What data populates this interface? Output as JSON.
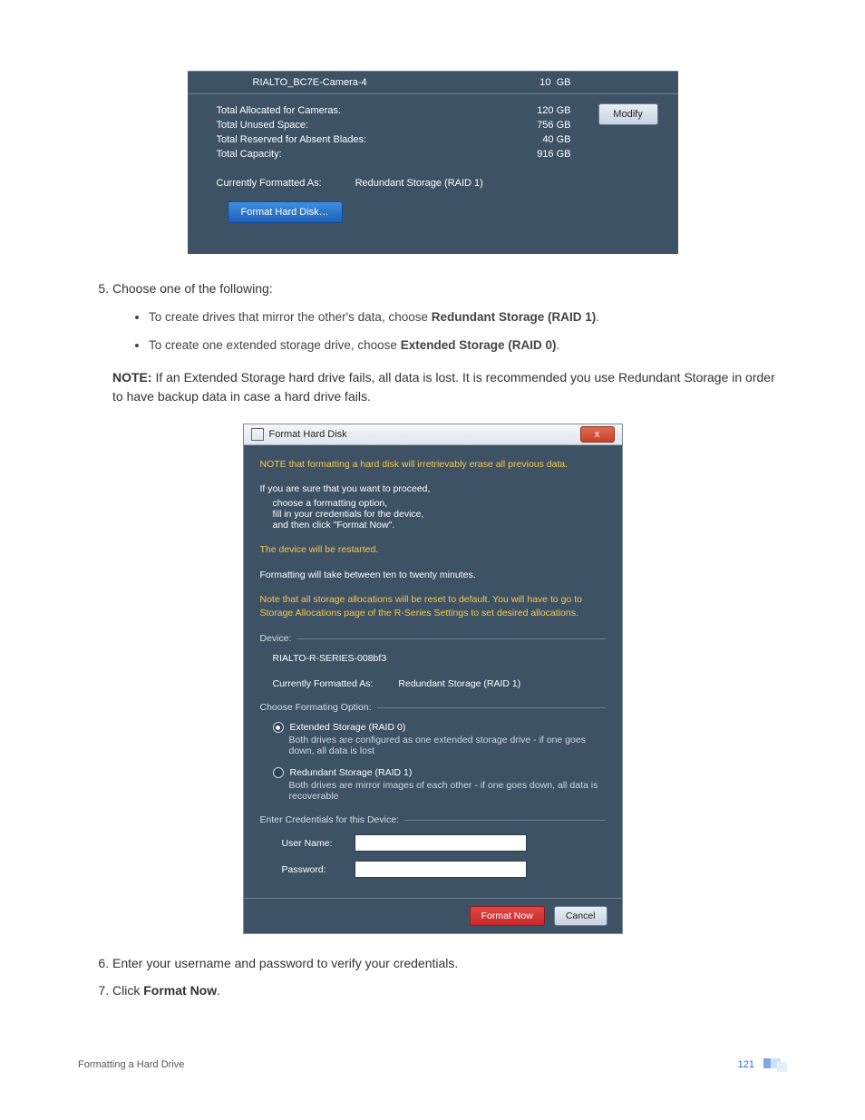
{
  "panel1": {
    "camera_name": "RIALTO_BC7E-Camera-4",
    "camera_value": "10",
    "camera_unit": "GB",
    "modify_label": "Modify",
    "totals": [
      {
        "label": "Total Allocated for Cameras:",
        "value": "120 GB"
      },
      {
        "label": "Total Unused Space:",
        "value": "756 GB"
      },
      {
        "label": "Total Reserved for Absent Blades:",
        "value": "40 GB"
      },
      {
        "label": "Total Capacity:",
        "value": "916 GB"
      }
    ],
    "currently_formatted_label": "Currently Formatted As:",
    "currently_formatted_value": "Redundant Storage (RAID 1)",
    "format_button": "Format Hard Disk…"
  },
  "step5": {
    "lead": "Choose one of the following:",
    "bullets": [
      {
        "pre": "To create drives that mirror the other's data, choose ",
        "bold": "Redundant Storage (RAID 1)",
        "post": "."
      },
      {
        "pre": "To create one extended storage drive, choose ",
        "bold": "Extended Storage (RAID 0)",
        "post": "."
      }
    ]
  },
  "note": {
    "label": "NOTE:",
    "text": " If an Extended Storage hard drive fails, all data is lost. It is recommended you use Redundant Storage in order to have backup data in case a hard drive fails."
  },
  "dialog": {
    "title": "Format Hard Disk",
    "close": "x",
    "line1": "NOTE that formatting a hard disk will irretrievably erase all previous data.",
    "line2_lead": "If you are sure that you want to proceed,",
    "line2_items": [
      "choose a formatting option,",
      "fill in your credentials for the device,",
      "and then click \"Format Now\"."
    ],
    "restart": "The device will be restarted.",
    "duration": "Formatting will take between ten to twenty minutes.",
    "reset_note": "Note that all storage allocations will be reset to default.   You will have to go to Storage Allocations page of the R-Series Settings to set desired allocations.",
    "device_section": "Device:",
    "device_name": "RIALTO-R-SERIES-008bf3",
    "currently_formatted_label": "Currently Formatted As:",
    "currently_formatted_value": "Redundant Storage (RAID 1)",
    "choose_section": "Choose Formating Option:",
    "options": [
      {
        "name": "Extended Storage (RAID 0)",
        "desc": "Both drives are configured as one extended storage drive - if one goes down, all data is lost",
        "selected": true
      },
      {
        "name": "Redundant Storage (RAID 1)",
        "desc": "Both drives are mirror images of each other - if one goes down, all data is recoverable",
        "selected": false
      }
    ],
    "creds_section": "Enter Credentials for this Device:",
    "username_label": "User Name:",
    "password_label": "Password:",
    "format_now": "Format Now",
    "cancel": "Cancel"
  },
  "step6": "Enter your username and password to verify your credentials.",
  "step7": {
    "pre": "Click ",
    "bold": "Format Now",
    "post": "."
  },
  "footer": {
    "name": "Formatting a Hard Drive",
    "page": "121"
  }
}
